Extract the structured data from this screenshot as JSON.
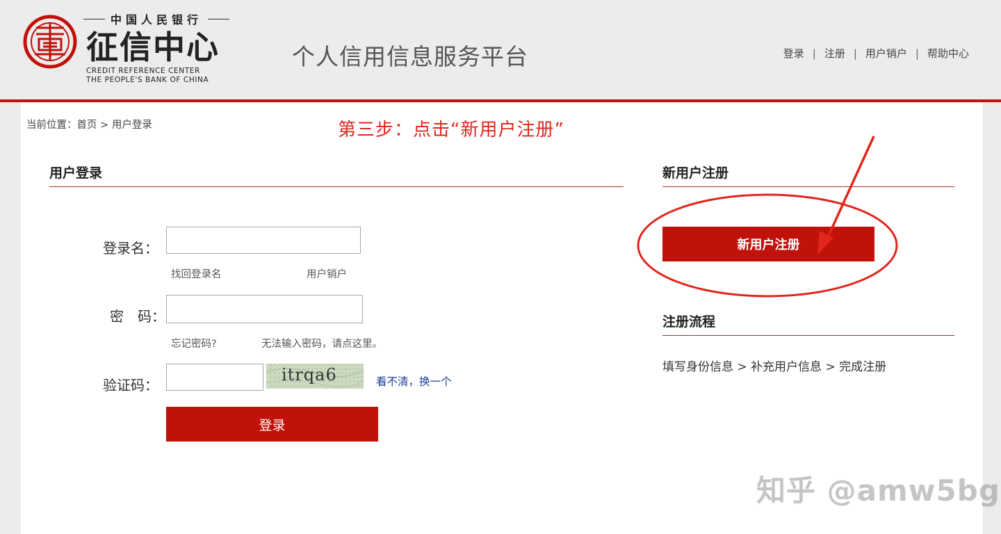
{
  "header": {
    "logo": {
      "org": "中国人民银行",
      "name": "征信中心",
      "english_line1": "CREDIT  REFERENCE  CENTER",
      "english_line2": "THE PEOPLE'S BANK OF CHINA"
    },
    "platform_title": "个人信用信息服务平台",
    "nav": [
      {
        "label": "登录"
      },
      {
        "label": "注册"
      },
      {
        "label": "用户销户"
      },
      {
        "label": "帮助中心"
      }
    ],
    "nav_separator": "|"
  },
  "breadcrumb": "当前位置：首页 > 用户登录",
  "annotation_text": "第三步：点击“新用户注册”",
  "login": {
    "title": "用户登录",
    "username_label": "登录名：",
    "username_value": "",
    "recover_username": "找回登录名",
    "cancel_account": "用户销户",
    "password_label": "密　码：",
    "password_value": "",
    "forgot_password": "忘记密码?",
    "cannot_input_password": "无法输入密码，请点这里。",
    "captcha_label": "验证码：",
    "captcha_value": "",
    "captcha_image_text": "itrqa6",
    "refresh_captcha": "看不清，换一个",
    "submit_label": "登录"
  },
  "register": {
    "title": "新用户注册",
    "button_label": "新用户注册",
    "process_title": "注册流程",
    "process_steps": "填写身份信息 > 补充用户信息 > 完成注册"
  },
  "watermark": "知乎 @amw5bg",
  "colors": {
    "brand_red": "#c0110a",
    "annotation_red": "#e0261d",
    "link_blue": "#1e3f95",
    "header_bg": "#ececec"
  }
}
